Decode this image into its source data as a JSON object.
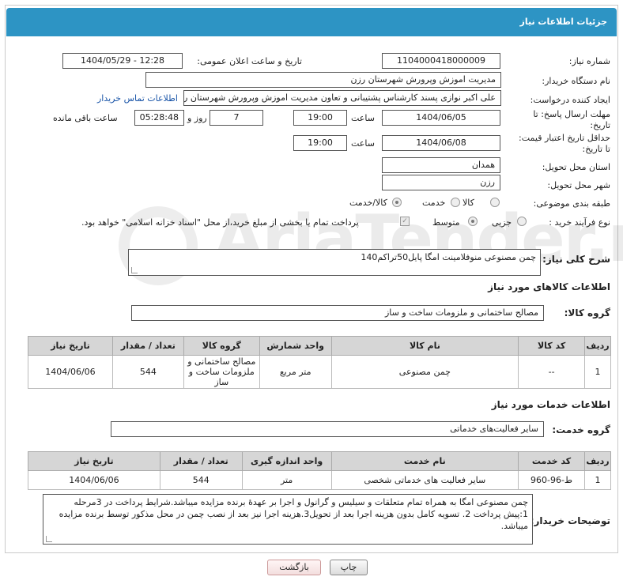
{
  "header": {
    "title": "جزئیات اطلاعات نیاز"
  },
  "watermark": {
    "text": "AriaTender.neT"
  },
  "fields": {
    "need_number": {
      "label": "شماره نیاز:",
      "value": "1104000418000009"
    },
    "announce_datetime": {
      "label": "تاریخ و ساعت اعلان عمومی:",
      "value": "1404/05/29 - 12:28"
    },
    "buyer_org": {
      "label": "نام دستگاه خریدار:",
      "value": "مدیریت اموزش وپرورش شهرستان رزن"
    },
    "requester": {
      "label": "ایجاد کننده درخواست:",
      "value": "علی اکبر نوازی پسند کارشناس پشتیبانی و تعاون مدیریت اموزش وپرورش شهرستان رزن",
      "link": "اطلاعات تماس خریدار"
    },
    "deadline": {
      "label": "مهلت ارسال پاسخ: تا تاریخ:",
      "date": "1404/06/05",
      "time_label": "ساعت",
      "time": "19:00",
      "days": "7",
      "days_label": "روز و",
      "remaining": "05:28:48",
      "remaining_label": "ساعت باقی مانده"
    },
    "price_validity": {
      "label": "حداقل تاریخ اعتبار قیمت: تا تاریخ:",
      "date": "1404/06/08",
      "time_label": "ساعت",
      "time": "19:00"
    },
    "province": {
      "label": "استان محل تحویل:",
      "value": "همدان"
    },
    "city": {
      "label": "شهر محل تحویل:",
      "value": "رزن"
    },
    "category": {
      "label": "طبقه بندی موضوعی:",
      "options": [
        "کالا",
        "خدمت",
        "کالا/خدمت"
      ],
      "selected": "کالا/خدمت"
    },
    "purchase_type": {
      "label": "نوع فرآیند خرید :",
      "options": [
        "جزیی",
        "متوسط"
      ],
      "selected": "متوسط",
      "note": "پرداخت تمام یا بخشی از مبلغ خرید،از محل \"اسناد خزانه اسلامی\" خواهد بود."
    }
  },
  "description": {
    "label": "شرح کلی نیاز:",
    "value": "چمن مصنوعی منوفلامینت امگا پایل50تراکم140"
  },
  "goods": {
    "section_title": "اطلاعات کالاهای مورد نیاز",
    "group_label": "گروه کالا:",
    "group_value": "مصالح ساختمانی و ملزومات ساخت و ساز",
    "columns": [
      "ردیف",
      "کد کالا",
      "نام کالا",
      "واحد شمارش",
      "گروه کالا",
      "تعداد / مقدار",
      "تاریخ نیاز"
    ],
    "rows": [
      {
        "row": "1",
        "code": "--",
        "name": "چمن مصنوعی",
        "unit": "متر مربع",
        "group": "مصالح ساختمانی و ملزومات ساخت و ساز",
        "qty": "544",
        "date": "1404/06/06"
      }
    ]
  },
  "services": {
    "section_title": "اطلاعات خدمات مورد نیاز",
    "group_label": "گروه خدمت:",
    "group_value": "سایر فعالیت‌های خدماتی",
    "columns": [
      "ردیف",
      "کد خدمت",
      "نام خدمت",
      "واحد اندازه گیری",
      "تعداد / مقدار",
      "تاریخ نیاز"
    ],
    "rows": [
      {
        "row": "1",
        "code": "ط-96-960",
        "name": "سایر فعالیت های خدماتی شخصی",
        "unit": "متر",
        "qty": "544",
        "date": "1404/06/06"
      }
    ]
  },
  "buyer_notes": {
    "label": "توضیحات خریدار:",
    "value": "چمن مصنوعی امگا به همراه تمام متعلقات و سیلیس و گرانول و اجرا بر عهدۀ برنده مزایده میباشد.شرایط پرداخت در 3مرحله 1:پیش پرداخت 2. تسویه کامل بدون هزینه اجرا بعد از تحویل3.هزینه اجرا نیز بعد از نصب چمن در محل مذکور توسط برنده مزایده میباشد."
  },
  "buttons": {
    "print": "چاپ",
    "back": "بازگشت"
  }
}
